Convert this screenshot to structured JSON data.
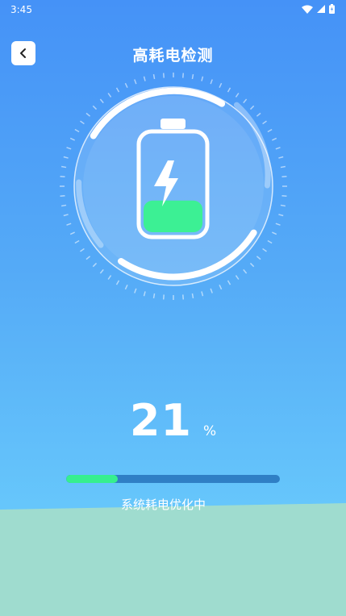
{
  "statusbar": {
    "time": "3:45"
  },
  "header": {
    "title": "高耗电检测"
  },
  "battery": {
    "level": 0.33
  },
  "progress": {
    "percent_value": "21",
    "percent_unit": "%",
    "fraction": 0.24
  },
  "status": {
    "message": "系统耗电优化中"
  },
  "colors": {
    "accent_green": "#3cf094",
    "track": "#2f7fc5"
  }
}
